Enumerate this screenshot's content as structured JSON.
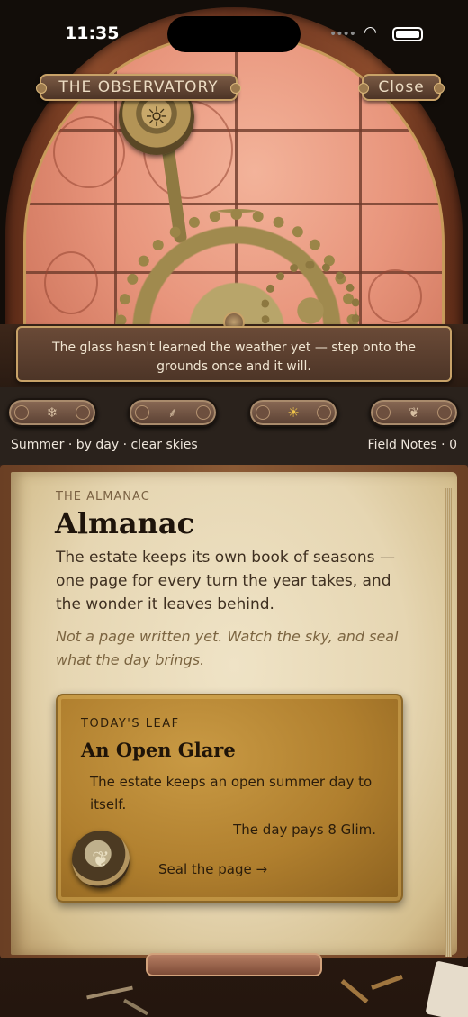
{
  "status_bar": {
    "time": "11:35"
  },
  "observatory": {
    "title": "THE OBSERVATORY",
    "close_label": "Close",
    "message": "The glass hasn't learned the weather yet — step onto the grounds once and it will."
  },
  "seasons": {
    "buttons": [
      {
        "icon": "snowflake-icon",
        "glyph": "❄"
      },
      {
        "icon": "sprout-icon",
        "glyph": "⸙"
      },
      {
        "icon": "sun-icon",
        "glyph": "☀"
      },
      {
        "icon": "leaf-icon",
        "glyph": "❦"
      }
    ],
    "status": "Summer · by day · clear skies",
    "field_notes": "Field Notes · 0"
  },
  "almanac": {
    "overline": "THE ALMANAC",
    "title": "Almanac",
    "intro": "The estate keeps its own book of seasons — one page for every turn the year takes, and the wonder it leaves behind.",
    "empty_note": "Not a page written yet. Watch the sky, and seal what the day brings.",
    "leaf": {
      "overline": "TODAY'S LEAF",
      "title": "An Open Glare",
      "text": "The estate keeps an open summer day to itself.",
      "reward": "The day pays 8 Glim.",
      "action": "Seal the page →"
    }
  },
  "colors": {
    "accent_gold": "#f0c54a",
    "card_gold": "#b07f2e",
    "parchment": "#e6d6b2"
  }
}
